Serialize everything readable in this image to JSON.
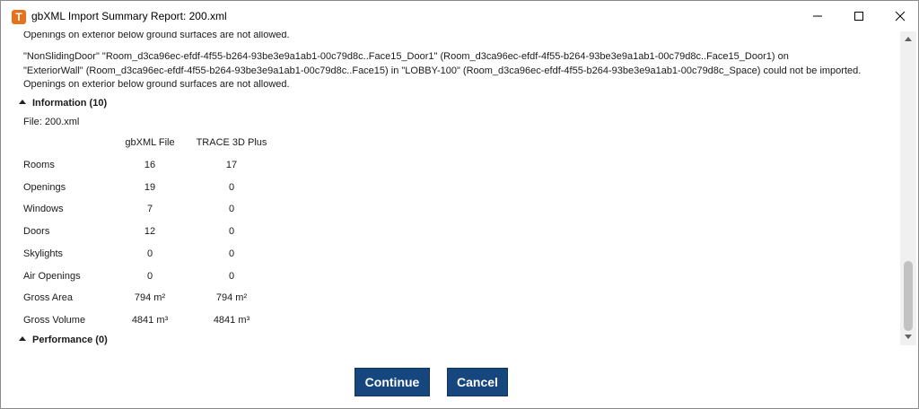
{
  "window": {
    "title": "gbXML Import Summary Report: 200.xml",
    "app_icon_letter": "T"
  },
  "messages": {
    "line1": "Openings on exterior below ground surfaces are not allowed.",
    "line2": "\"NonSlidingDoor\" \"Room_d3ca96ec-efdf-4f55-b264-93be3e9a1ab1-00c79d8c..Face15_Door1\" (Room_d3ca96ec-efdf-4f55-b264-93be3e9a1ab1-00c79d8c..Face15_Door1) on",
    "line3": "\"ExteriorWall\" (Room_d3ca96ec-efdf-4f55-b264-93be3e9a1ab1-00c79d8c..Face15) in \"LOBBY-100\" (Room_d3ca96ec-efdf-4f55-b264-93be3e9a1ab1-00c79d8c_Space) could not be imported.",
    "line4": "Openings on exterior below ground surfaces are not allowed."
  },
  "information": {
    "header": "Information (10)",
    "file_label": "File: 200.xml",
    "columns": [
      "gbXML File",
      "TRACE 3D Plus"
    ],
    "rows": [
      {
        "label": "Rooms",
        "gbxml": "16",
        "trace": "17"
      },
      {
        "label": "Openings",
        "gbxml": "19",
        "trace": "0"
      },
      {
        "label": "Windows",
        "gbxml": "7",
        "trace": "0"
      },
      {
        "label": "Doors",
        "gbxml": "12",
        "trace": "0"
      },
      {
        "label": "Skylights",
        "gbxml": "0",
        "trace": "0"
      },
      {
        "label": "Air Openings",
        "gbxml": "0",
        "trace": "0"
      },
      {
        "label": "Gross Area",
        "gbxml": "794 m²",
        "trace": "794 m²"
      },
      {
        "label": "Gross Volume",
        "gbxml": "4841 m³",
        "trace": "4841 m³"
      }
    ]
  },
  "performance": {
    "header": "Performance (0)"
  },
  "footer": {
    "continue_label": "Continue",
    "cancel_label": "Cancel"
  }
}
